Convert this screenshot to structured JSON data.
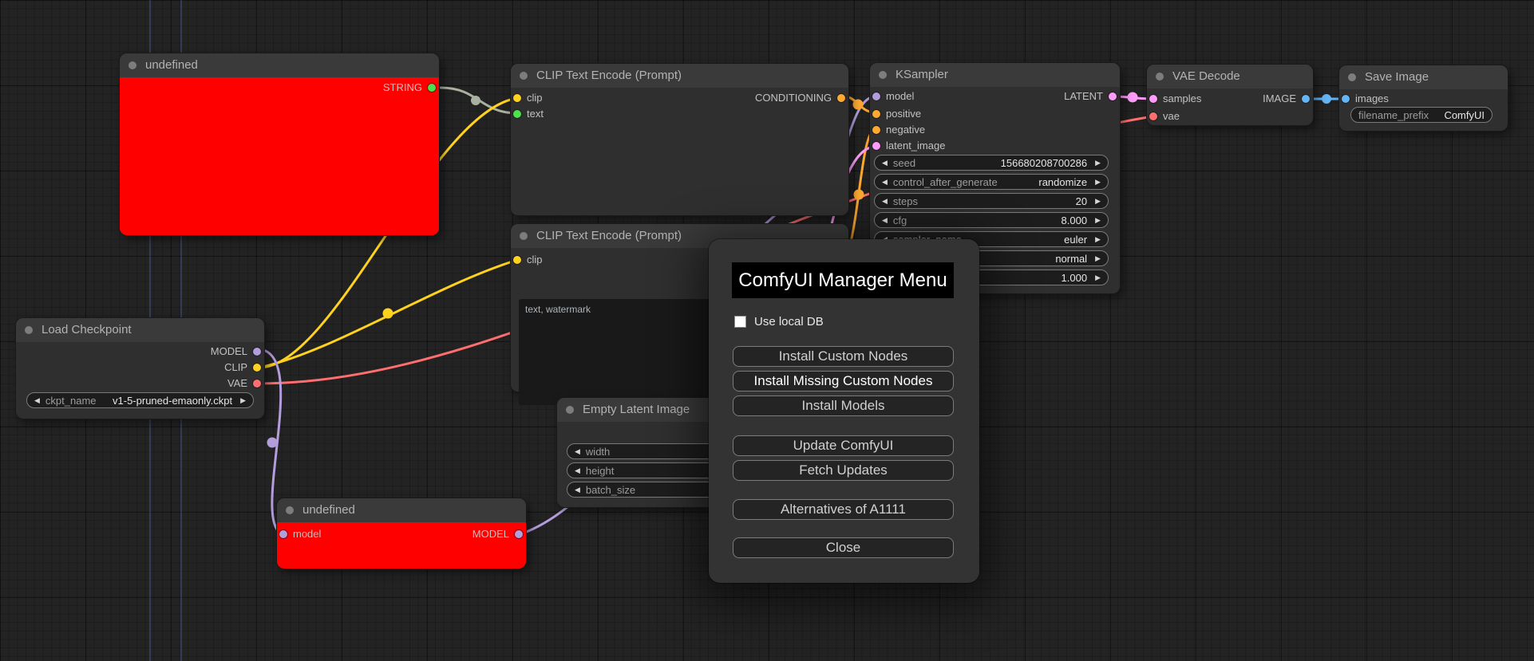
{
  "colors": {
    "model": "#b39ddb",
    "clip": "#ffd21e",
    "vae": "#ff6e6e",
    "conditioning": "#ffa931",
    "latent": "#ff9cf9",
    "image": "#64b5f6",
    "string": "#4be34b",
    "string_wire": "#a9b2a0",
    "title_dot": "#7d7d7d",
    "node_error": "#ff0000"
  },
  "nodes": {
    "string_node": {
      "title": "undefined",
      "outputs": [
        "STRING"
      ]
    },
    "clip_encode_1": {
      "title": "CLIP Text Encode (Prompt)",
      "inputs": [
        "clip",
        "text"
      ],
      "outputs": [
        "CONDITIONING"
      ]
    },
    "clip_encode_2": {
      "title": "CLIP Text Encode (Prompt)",
      "inputs": [
        "clip"
      ],
      "text_value": "text, watermark"
    },
    "ksampler": {
      "title": "KSampler",
      "inputs": [
        "model",
        "positive",
        "negative",
        "latent_image"
      ],
      "outputs": [
        "LATENT"
      ],
      "widgets": [
        {
          "label": "seed",
          "value": "156680208700286"
        },
        {
          "label": "control_after_generate",
          "value": "randomize"
        },
        {
          "label": "steps",
          "value": "20"
        },
        {
          "label": "cfg",
          "value": "8.000"
        },
        {
          "label": "sampler_name",
          "value": "euler"
        },
        {
          "label": "",
          "value": "normal"
        },
        {
          "label": "",
          "value": "1.000"
        }
      ]
    },
    "vae_decode": {
      "title": "VAE Decode",
      "inputs": [
        "samples",
        "vae"
      ],
      "outputs": [
        "IMAGE"
      ]
    },
    "save_image": {
      "title": "Save Image",
      "inputs": [
        "images"
      ],
      "widgets": [
        {
          "label": "filename_prefix",
          "value": "ComfyUI"
        }
      ]
    },
    "load_checkpoint": {
      "title": "Load Checkpoint",
      "outputs": [
        "MODEL",
        "CLIP",
        "VAE"
      ],
      "widgets": [
        {
          "label": "ckpt_name",
          "value": "v1-5-pruned-emaonly.ckpt"
        }
      ]
    },
    "empty_latent": {
      "title": "Empty Latent Image",
      "widgets": [
        {
          "label": "width",
          "value": ""
        },
        {
          "label": "height",
          "value": ""
        },
        {
          "label": "batch_size",
          "value": ""
        }
      ]
    },
    "model_node": {
      "title": "undefined",
      "inputs": [
        "model"
      ],
      "outputs": [
        "MODEL"
      ]
    }
  },
  "dialog": {
    "title": "ComfyUI Manager Menu",
    "checkbox_label": "Use local DB",
    "checkbox_checked": false,
    "buttons": [
      {
        "label": "Install Custom Nodes"
      },
      {
        "label": "Install Missing Custom Nodes"
      },
      {
        "label": "Install Models"
      },
      {
        "label": "Update ComfyUI"
      },
      {
        "label": "Fetch Updates"
      },
      {
        "label": "Alternatives of A1111"
      },
      {
        "label": "Close"
      }
    ]
  }
}
